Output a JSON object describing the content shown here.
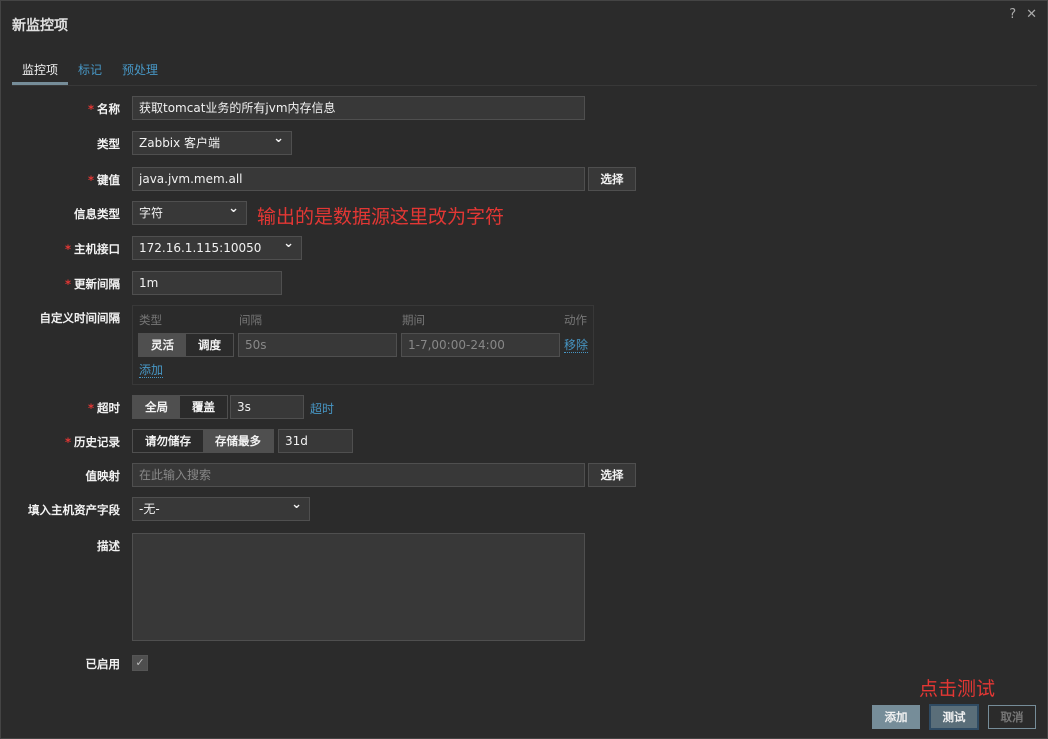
{
  "dialog": {
    "title": "新监控项",
    "help_icon": "?",
    "close_icon": "✕"
  },
  "tabs": [
    "监控项",
    "标记",
    "预处理"
  ],
  "form": {
    "name": {
      "label": "名称",
      "value": "获取tomcat业务的所有jvm内存信息"
    },
    "type": {
      "label": "类型",
      "value": "Zabbix 客户端"
    },
    "key": {
      "label": "键值",
      "value": "java.jvm.mem.all",
      "button": "选择"
    },
    "info_type": {
      "label": "信息类型",
      "value": "字符",
      "annotation": "输出的是数据源这里改为字符"
    },
    "interface": {
      "label": "主机接口",
      "value": "172.16.1.115:10050"
    },
    "update_interval": {
      "label": "更新间隔",
      "value": "1m"
    },
    "custom_intervals": {
      "label": "自定义时间间隔",
      "headers": [
        "类型",
        "间隔",
        "期间",
        "动作"
      ],
      "modes": [
        "灵活",
        "调度"
      ],
      "interval": "50s",
      "period": "1-7,00:00-24:00",
      "remove": "移除",
      "add": "添加"
    },
    "timeout": {
      "label": "超时",
      "modes": [
        "全局",
        "覆盖"
      ],
      "value": "3s",
      "link": "超时"
    },
    "history": {
      "label": "历史记录",
      "modes": [
        "请勿储存",
        "存储最多"
      ],
      "value": "31d"
    },
    "value_map": {
      "label": "值映射",
      "placeholder": "在此输入搜索",
      "button": "选择"
    },
    "inventory": {
      "label": "填入主机资产字段",
      "value": "-无-"
    },
    "description": {
      "label": "描述",
      "value": ""
    },
    "enabled": {
      "label": "已启用",
      "checked": true
    }
  },
  "footer": {
    "annotation": "点击测试",
    "add": "添加",
    "test": "测试",
    "cancel": "取消"
  }
}
